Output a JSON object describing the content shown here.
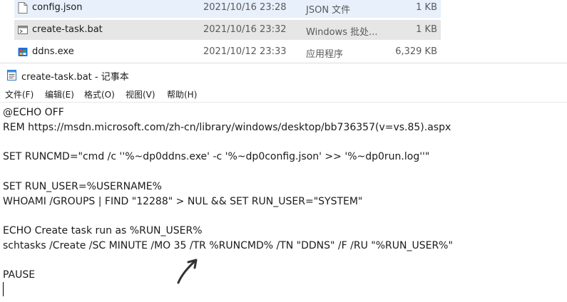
{
  "explorer": {
    "files": [
      {
        "name": "config.json",
        "date": "2021/10/16 23:28",
        "type": "JSON 文件",
        "size": "1 KB",
        "icon": "json-file-icon",
        "state": "hover"
      },
      {
        "name": "create-task.bat",
        "date": "2021/10/16 23:32",
        "type": "Windows 批处...",
        "size": "1 KB",
        "icon": "batch-file-icon",
        "state": "selected"
      },
      {
        "name": "ddns.exe",
        "date": "2021/10/12 23:33",
        "type": "应用程序",
        "size": "6,329 KB",
        "icon": "exe-file-icon",
        "state": "normal"
      }
    ]
  },
  "notepad": {
    "title": "create-task.bat - 记事本",
    "title_icon": "notepad-icon",
    "menu": [
      "文件(F)",
      "编辑(E)",
      "格式(O)",
      "视图(V)",
      "帮助(H)"
    ],
    "lines": [
      "@ECHO OFF",
      "REM https://msdn.microsoft.com/zh-cn/library/windows/desktop/bb736357(v=vs.85).aspx",
      "",
      "SET RUNCMD=\"cmd /c ''%~dp0ddns.exe' -c '%~dp0config.json' >> '%~dp0run.log''\"",
      "",
      "SET RUN_USER=%USERNAME%",
      "WHOAMI /GROUPS | FIND \"12288\" > NUL && SET RUN_USER=\"SYSTEM\"",
      "",
      "ECHO Create task run as %RUN_USER%",
      "schtasks /Create /SC MINUTE /MO 35 /TR %RUNCMD% /TN \"DDNS\" /F /RU \"%RUN_USER%\"",
      "",
      "PAUSE"
    ]
  },
  "colors": {
    "hover_row": "#e7f0fb",
    "selected_row": "#e6e6e6",
    "annotation": "#333333"
  }
}
